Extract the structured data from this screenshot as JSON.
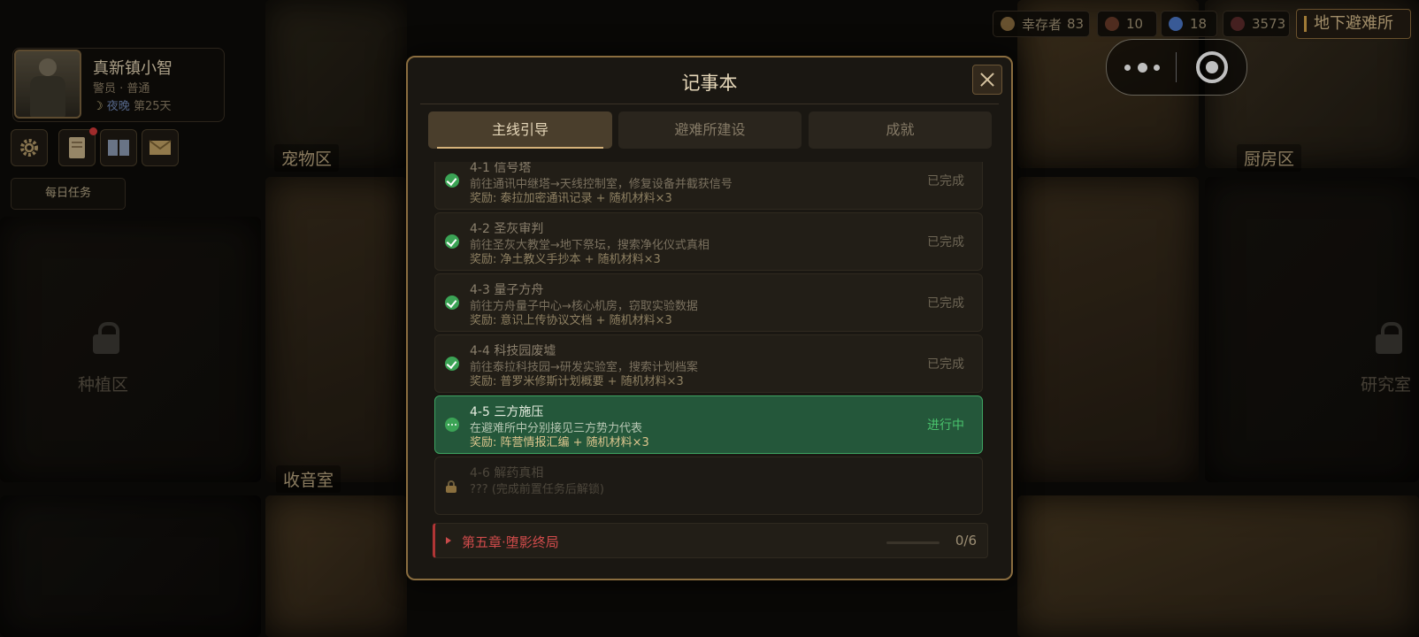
{
  "player": {
    "name": "真新镇小智",
    "role": "警员 · 普通",
    "period": "夜晚",
    "day": "第25天"
  },
  "toolbar": {
    "settings_icon": "gear-icon",
    "notebook_icon": "notebook-icon",
    "book_icon": "book-icon",
    "mail_icon": "mail-icon",
    "daily_tasks": "每日任务"
  },
  "resources": {
    "survivors_label": "幸存者",
    "survivors": "83",
    "res2": "10",
    "res3": "18",
    "res4": "3573",
    "shelter_button": "地下避难所"
  },
  "map": {
    "rooms": {
      "pet": "宠物区",
      "kitchen": "厨房区",
      "radio": "收音室",
      "plant": "种植区",
      "research": "研究室"
    }
  },
  "notebook": {
    "title": "记事本",
    "tabs": [
      "主线引导",
      "避难所建设",
      "成就"
    ],
    "quests": [
      {
        "title": "4-1 信号塔",
        "desc": "前往通讯中继塔→天线控制室，修复设备并截获信号",
        "reward": "奖励: 泰拉加密通讯记录 + 随机材料×3",
        "status": "已完成",
        "state": "done"
      },
      {
        "title": "4-2 圣灰审判",
        "desc": "前往圣灰大教堂→地下祭坛，搜索净化仪式真相",
        "reward": "奖励: 净土教义手抄本 + 随机材料×3",
        "status": "已完成",
        "state": "done"
      },
      {
        "title": "4-3 量子方舟",
        "desc": "前往方舟量子中心→核心机房，窃取实验数据",
        "reward": "奖励: 意识上传协议文档 + 随机材料×3",
        "status": "已完成",
        "state": "done"
      },
      {
        "title": "4-4 科技园废墟",
        "desc": "前往泰拉科技园→研发实验室，搜索计划档案",
        "reward": "奖励: 普罗米修斯计划概要 + 随机材料×3",
        "status": "已完成",
        "state": "done"
      },
      {
        "title": "4-5 三方施压",
        "desc": "在避难所中分别接见三方势力代表",
        "reward": "奖励: 阵营情报汇编 + 随机材料×3",
        "status": "进行中",
        "state": "active"
      },
      {
        "title": "4-6 解药真相",
        "desc": "??? (完成前置任务后解锁)",
        "reward": "",
        "status": "",
        "state": "locked"
      }
    ],
    "next_chapter": {
      "name": "第五章·堕影终局",
      "progress": "0/6",
      "progress_fraction": 0
    }
  },
  "colors": {
    "accent_gold": "#8a6d3f",
    "done_green": "#3ba355",
    "active_bg": "#24573a",
    "chapter_red": "#d04b4b"
  }
}
